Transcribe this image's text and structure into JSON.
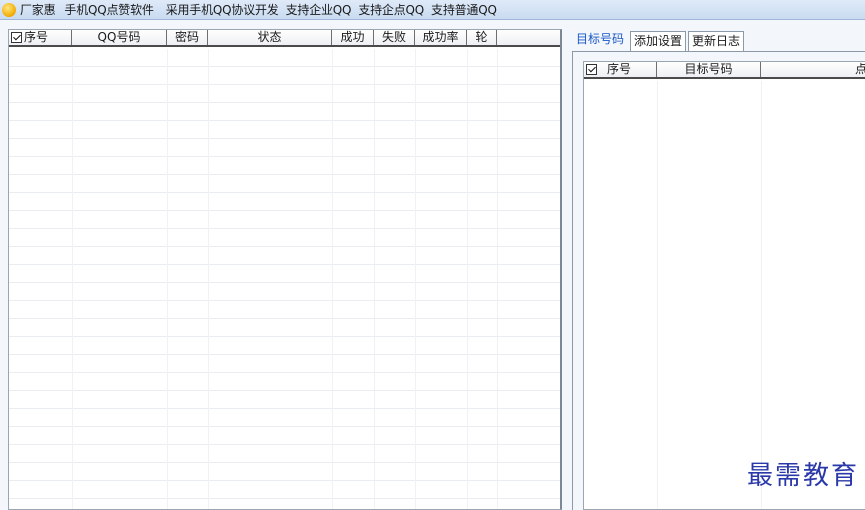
{
  "titlebar": {
    "app_name": "厂家惠",
    "segments": [
      "手机QQ点赞软件",
      "采用手机QQ协议开发",
      "支持企业QQ",
      "支持企点QQ",
      "支持普通QQ"
    ]
  },
  "main_table": {
    "columns": [
      "序号",
      "QQ号码",
      "密码",
      "状态",
      "成功",
      "失败",
      "成功率",
      "轮"
    ],
    "select_all_checked": true,
    "rows": []
  },
  "tabs": [
    "目标号码",
    "添加设置",
    "更新日志"
  ],
  "active_tab": "目标号码",
  "target_table": {
    "columns": [
      "序号",
      "目标号码",
      "点赞"
    ],
    "select_all_checked": true,
    "rows": []
  },
  "watermark": "最需教育",
  "colors": {
    "titlebar": "#c9dbf1",
    "active_tab_text": "#1a57c7",
    "watermark": "#2a38a8"
  }
}
